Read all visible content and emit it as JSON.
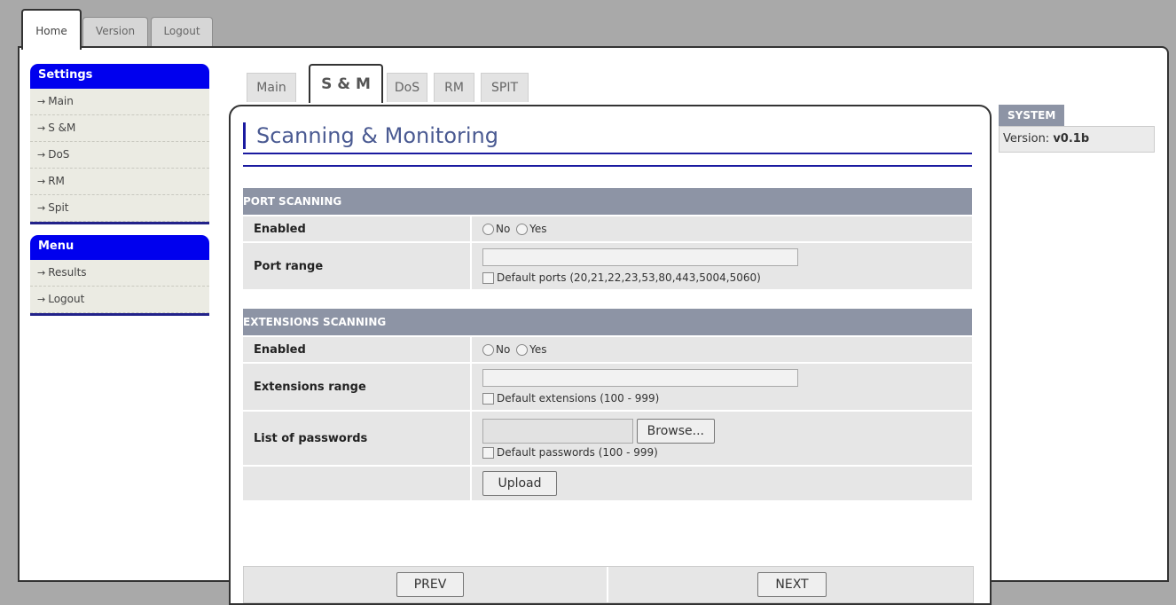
{
  "top_tabs": [
    "Home",
    "Version",
    "Logout"
  ],
  "sidebar": {
    "settings_title": "Settings",
    "settings_items": [
      "Main",
      "S &M",
      "DoS",
      "RM",
      "Spit"
    ],
    "menu_title": "Menu",
    "menu_items": [
      "Results",
      "Logout"
    ]
  },
  "sub_tabs": [
    "Main",
    "S & M",
    "DoS",
    "RM",
    "SPIT"
  ],
  "page_title": "Scanning & Monitoring",
  "port_scanning": {
    "header": "PORT SCANNING",
    "enabled_label": "Enabled",
    "no_label": "No",
    "yes_label": "Yes",
    "range_label": "Port range",
    "default_label": "Default ports (20,21,22,23,53,80,443,5004,5060)"
  },
  "extensions_scanning": {
    "header": "EXTENSIONS SCANNING",
    "enabled_label": "Enabled",
    "no_label": "No",
    "yes_label": "Yes",
    "range_label": "Extensions range",
    "default_label": "Default extensions (100 - 999)",
    "passwords_label": "List of passwords",
    "browse_label": "Browse...",
    "default_passwords_label": "Default passwords (100 - 999)",
    "upload_label": "Upload"
  },
  "nav": {
    "prev": "PREV",
    "next": "NEXT"
  },
  "system": {
    "title": "SYSTEM",
    "version_label": "Version:",
    "version_value": "v0.1b"
  },
  "colors": {
    "accent_blue": "#0000ee",
    "rule_blue": "#1a1aa0",
    "section_gray": "#8d94a5",
    "row_gray": "#e6e6e6"
  }
}
